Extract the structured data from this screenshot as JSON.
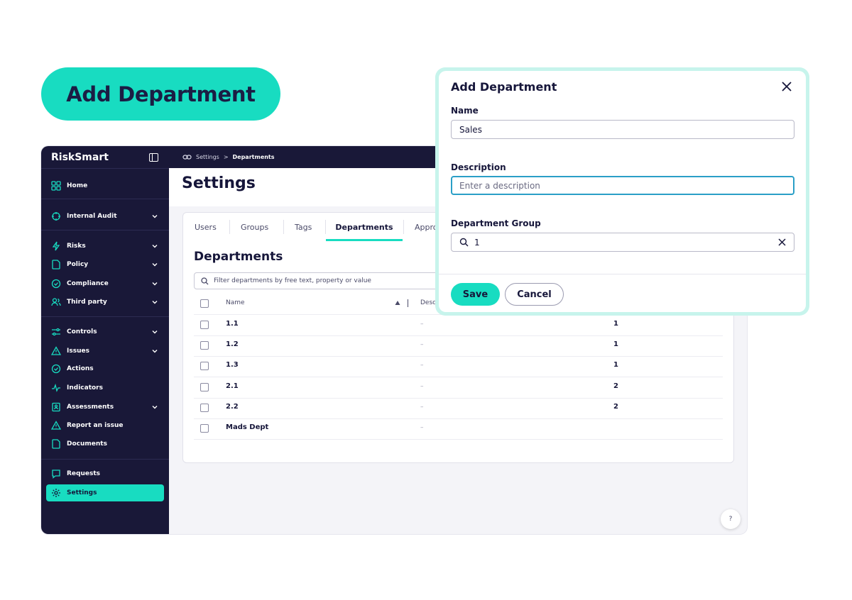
{
  "hero": {
    "label": "Add Department"
  },
  "sidebar": {
    "brand": "RiskSmart",
    "items": [
      {
        "label": "Home",
        "icon": "grid-icon"
      },
      {
        "label": "Internal Audit",
        "icon": "audit-icon"
      },
      {
        "label": "Risks",
        "icon": "lightning-icon"
      },
      {
        "label": "Policy",
        "icon": "document-icon"
      },
      {
        "label": "Compliance",
        "icon": "check-circle-icon"
      },
      {
        "label": "Third party",
        "icon": "users-icon"
      },
      {
        "label": "Controls",
        "icon": "sliders-icon"
      },
      {
        "label": "Issues",
        "icon": "warning-icon"
      },
      {
        "label": "Actions",
        "icon": "check-circle-icon"
      },
      {
        "label": "Indicators",
        "icon": "pulse-icon"
      },
      {
        "label": "Assessments",
        "icon": "clipboard-icon"
      },
      {
        "label": "Report an issue",
        "icon": "warning-icon"
      },
      {
        "label": "Documents",
        "icon": "document-icon"
      },
      {
        "label": "Requests",
        "icon": "chat-icon"
      },
      {
        "label": "Settings",
        "icon": "gear-icon"
      }
    ]
  },
  "breadcrumb": {
    "parent": "Settings",
    "separator": ">",
    "current": "Departments"
  },
  "page": {
    "title": "Settings"
  },
  "tabs": [
    "Users",
    "Groups",
    "Tags",
    "Departments",
    "Appro"
  ],
  "departments": {
    "title": "Departments",
    "filter_placeholder": "Filter departments by free text, property or value",
    "columns": {
      "name": "Name",
      "description": "Desc"
    },
    "rows": [
      {
        "name": "1.1",
        "description": "–",
        "group": "1"
      },
      {
        "name": "1.2",
        "description": "–",
        "group": "1"
      },
      {
        "name": "1.3",
        "description": "–",
        "group": "1"
      },
      {
        "name": "2.1",
        "description": "–",
        "group": "2"
      },
      {
        "name": "2.2",
        "description": "–",
        "group": "2"
      },
      {
        "name": "Mads Dept",
        "description": "–",
        "group": ""
      }
    ]
  },
  "help": {
    "label": "?"
  },
  "modal": {
    "title": "Add Department",
    "name_label": "Name",
    "name_value": "Sales",
    "description_label": "Description",
    "description_placeholder": "Enter a description",
    "group_label": "Department Group",
    "group_value": "1",
    "save_label": "Save",
    "cancel_label": "Cancel"
  },
  "colors": {
    "accent": "#18dcc1",
    "sidebar_bg": "#191838",
    "text_dark": "#16163a",
    "focus_border": "#2a9fc7"
  }
}
